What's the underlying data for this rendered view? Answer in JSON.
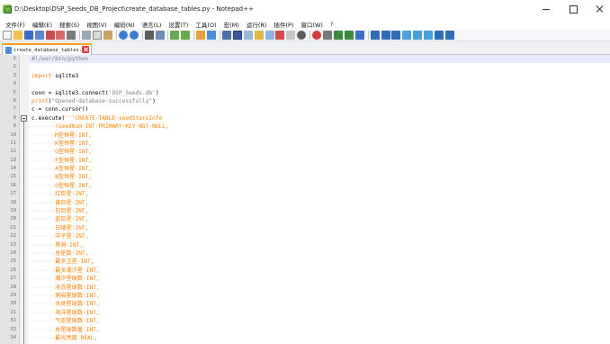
{
  "window": {
    "title": "D:\\Desktop\\DSP_Seeds_DB_Project\\create_database_tables.py - Notepad++"
  },
  "menu": [
    "文件(F)",
    "编辑(E)",
    "搜索(S)",
    "视图(V)",
    "编码(N)",
    "语言(L)",
    "设置(T)",
    "工具(O)",
    "宏(M)",
    "运行(R)",
    "插件(P)",
    "窗口(W)",
    "?"
  ],
  "tab": {
    "label": "create_database_tables.py"
  },
  "colors": {
    "comment": "#808080",
    "keyword": "#ff8000",
    "keyword2": "#0000ff",
    "string": "#808080",
    "sql": "#ff8000",
    "default": "#000000",
    "whitespace": "#c0c0c0",
    "accent": "#f7a21b"
  },
  "editor": {
    "current_line": 1,
    "lines": [
      {
        "num": "1",
        "segments": [
          {
            "t": "#!/usr/bin/python",
            "c": "comment"
          }
        ]
      },
      {
        "num": "2",
        "segments": []
      },
      {
        "num": "3",
        "segments": [
          {
            "t": "import",
            "c": "keyword"
          },
          {
            "t": "·",
            "c": "whitespace"
          },
          {
            "t": "sqlite3",
            "c": "default"
          }
        ]
      },
      {
        "num": "4",
        "segments": []
      },
      {
        "num": "5",
        "segments": [
          {
            "t": "conn",
            "c": "default"
          },
          {
            "t": "·",
            "c": "whitespace"
          },
          {
            "t": "=",
            "c": "default"
          },
          {
            "t": "·",
            "c": "whitespace"
          },
          {
            "t": "sqlite3.connect(",
            "c": "default"
          },
          {
            "t": "'DSP_Seeds.db'",
            "c": "string"
          },
          {
            "t": ")",
            "c": "default"
          }
        ]
      },
      {
        "num": "6",
        "segments": [
          {
            "t": "print",
            "c": "keyword"
          },
          {
            "t": "(",
            "c": "default"
          },
          {
            "t": "\"Opened·database·successfully\"",
            "c": "string"
          },
          {
            "t": ")",
            "c": "default"
          }
        ]
      },
      {
        "num": "7",
        "segments": [
          {
            "t": "c",
            "c": "default"
          },
          {
            "t": "·",
            "c": "whitespace"
          },
          {
            "t": "=",
            "c": "default"
          },
          {
            "t": "·",
            "c": "whitespace"
          },
          {
            "t": "conn.cursor()",
            "c": "default"
          }
        ]
      },
      {
        "num": "8",
        "segments": [
          {
            "t": "c.execute(",
            "c": "default"
          },
          {
            "t": "'''CREATE·TABLE·seedStarsInfo",
            "c": "sql"
          }
        ]
      },
      {
        "num": "9",
        "segments": [
          {
            "t": "·······",
            "c": "whitespace"
          },
          {
            "t": "(seedNum·INT·PRIMARY·KEY·NOT·NULL,",
            "c": "sql"
          }
        ]
      },
      {
        "num": "10",
        "segments": [
          {
            "t": "·······",
            "c": "whitespace"
          },
          {
            "t": "M型恒星·INT,",
            "c": "sql"
          }
        ]
      },
      {
        "num": "11",
        "segments": [
          {
            "t": "·······",
            "c": "whitespace"
          },
          {
            "t": "K型恒星·INT,",
            "c": "sql"
          }
        ]
      },
      {
        "num": "12",
        "segments": [
          {
            "t": "·······",
            "c": "whitespace"
          },
          {
            "t": "G型恒星·INT,",
            "c": "sql"
          }
        ]
      },
      {
        "num": "13",
        "segments": [
          {
            "t": "·······",
            "c": "whitespace"
          },
          {
            "t": "F型恒星·INT,",
            "c": "sql"
          }
        ]
      },
      {
        "num": "14",
        "segments": [
          {
            "t": "·······",
            "c": "whitespace"
          },
          {
            "t": "A型恒星·INT,",
            "c": "sql"
          }
        ]
      },
      {
        "num": "15",
        "segments": [
          {
            "t": "·······",
            "c": "whitespace"
          },
          {
            "t": "B型恒星·INT,",
            "c": "sql"
          }
        ]
      },
      {
        "num": "16",
        "segments": [
          {
            "t": "·······",
            "c": "whitespace"
          },
          {
            "t": "O型恒星·INT,",
            "c": "sql"
          }
        ]
      },
      {
        "num": "17",
        "segments": [
          {
            "t": "·······",
            "c": "whitespace"
          },
          {
            "t": "红巨星·INT,",
            "c": "sql"
          }
        ]
      },
      {
        "num": "18",
        "segments": [
          {
            "t": "·······",
            "c": "whitespace"
          },
          {
            "t": "黄巨星·INT,",
            "c": "sql"
          }
        ]
      },
      {
        "num": "19",
        "segments": [
          {
            "t": "·······",
            "c": "whitespace"
          },
          {
            "t": "白巨星·INT,",
            "c": "sql"
          }
        ]
      },
      {
        "num": "20",
        "segments": [
          {
            "t": "·······",
            "c": "whitespace"
          },
          {
            "t": "蓝巨星·INT,",
            "c": "sql"
          }
        ]
      },
      {
        "num": "21",
        "segments": [
          {
            "t": "·······",
            "c": "whitespace"
          },
          {
            "t": "白矮星·INT,",
            "c": "sql"
          }
        ]
      },
      {
        "num": "22",
        "segments": [
          {
            "t": "·······",
            "c": "whitespace"
          },
          {
            "t": "中子星·INT,",
            "c": "sql"
          }
        ]
      },
      {
        "num": "23",
        "segments": [
          {
            "t": "·······",
            "c": "whitespace"
          },
          {
            "t": "黑洞·INT,",
            "c": "sql"
          }
        ]
      },
      {
        "num": "24",
        "segments": [
          {
            "t": "·······",
            "c": "whitespace"
          },
          {
            "t": "总星数·INT,",
            "c": "sql"
          }
        ]
      },
      {
        "num": "25",
        "segments": [
          {
            "t": "·······",
            "c": "whitespace"
          },
          {
            "t": "最多卫星·INT,",
            "c": "sql"
          }
        ]
      },
      {
        "num": "26",
        "segments": [
          {
            "t": "·······",
            "c": "whitespace"
          },
          {
            "t": "最多潮汐星·INT,",
            "c": "sql"
          }
        ]
      },
      {
        "num": "27",
        "segments": [
          {
            "t": "·······",
            "c": "whitespace"
          },
          {
            "t": "潮汐星球数·INT,",
            "c": "sql"
          }
        ]
      },
      {
        "num": "28",
        "segments": [
          {
            "t": "·······",
            "c": "whitespace"
          },
          {
            "t": "冰冻星球数·INT,",
            "c": "sql"
          }
        ]
      },
      {
        "num": "29",
        "segments": [
          {
            "t": "·······",
            "c": "whitespace"
          },
          {
            "t": "熔岩星球数·INT,",
            "c": "sql"
          }
        ]
      },
      {
        "num": "30",
        "segments": [
          {
            "t": "·······",
            "c": "whitespace"
          },
          {
            "t": "水体星球数·INT,",
            "c": "sql"
          }
        ]
      },
      {
        "num": "31",
        "segments": [
          {
            "t": "·······",
            "c": "whitespace"
          },
          {
            "t": "海洋星球数·INT,",
            "c": "sql"
          }
        ]
      },
      {
        "num": "32",
        "segments": [
          {
            "t": "·······",
            "c": "whitespace"
          },
          {
            "t": "气态星球数·INT,",
            "c": "sql"
          }
        ]
      },
      {
        "num": "33",
        "segments": [
          {
            "t": "·······",
            "c": "whitespace"
          },
          {
            "t": "总星球数量·INT,",
            "c": "sql"
          }
        ]
      },
      {
        "num": "34",
        "segments": [
          {
            "t": "·······",
            "c": "whitespace"
          },
          {
            "t": "最光亮度·REAL,",
            "c": "sql"
          }
        ]
      }
    ]
  }
}
